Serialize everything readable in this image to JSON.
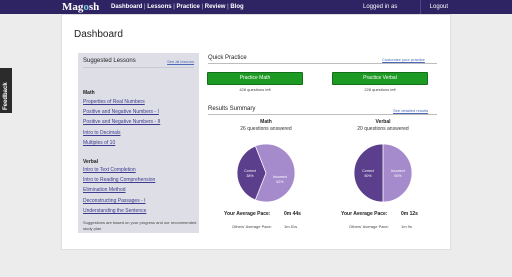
{
  "header": {
    "logo_left": "Mag",
    "logo_o": "o",
    "logo_right": "sh",
    "nav": [
      "Dashboard",
      "Lessons",
      "Practice",
      "Review",
      "Blog"
    ],
    "logged_in": "Logged in as",
    "logout": "Logout"
  },
  "feedback": "Feedback",
  "page": {
    "title": "Dashboard"
  },
  "lessons": {
    "heading": "Suggested Lessons",
    "see_all": "See all lessons",
    "math_heading": "Math",
    "math_items": [
      "Properties of Real Numbers",
      "Positive and Negative Numbers - I",
      "Positive and Negative Numbers - II",
      "Intro to Decimals",
      "Multiples of 10"
    ],
    "verbal_heading": "Verbal",
    "verbal_items": [
      "Intro to Text Completion",
      "Intro to Reading Comprehension",
      "Elimination Method",
      "Deconstructing Passages - I",
      "Understanding the Sentence"
    ],
    "note": "Suggestions are based on your progress and our recommended study plan"
  },
  "quick_practice": {
    "heading": "Quick Practice",
    "customize": "Customize your practice",
    "math_button": "Practice Math",
    "math_left": "428 questions left",
    "verbal_button": "Practice Verbal",
    "verbal_left": "228 questions left"
  },
  "results": {
    "heading": "Results Summary",
    "see_detailed": "See detailed results",
    "math": {
      "title": "Math",
      "answered": "26 questions answered",
      "correct_label": "Correct",
      "correct_pct": "38%",
      "incorrect_label": "Incorrect",
      "incorrect_pct": "62%",
      "correct_fraction": 0.38,
      "your_pace_label": "Your Average Pace:",
      "your_pace": "0m 44s",
      "others_pace_label": "Others' Average Pace:",
      "others_pace": "1m 51s"
    },
    "verbal": {
      "title": "Verbal",
      "answered": "20 questions answered",
      "correct_label": "Correct",
      "correct_pct": "50%",
      "incorrect_label": "Incorrect",
      "incorrect_pct": "50%",
      "correct_fraction": 0.5,
      "your_pace_label": "Your Average Pace:",
      "your_pace": "0m 12s",
      "others_pace_label": "Others' Average Pace:",
      "others_pace": "1m 9s"
    }
  },
  "colors": {
    "header": "#2e2463",
    "correct": "#5b3f8c",
    "incorrect": "#a68bcc",
    "button": "#1c9a23"
  }
}
